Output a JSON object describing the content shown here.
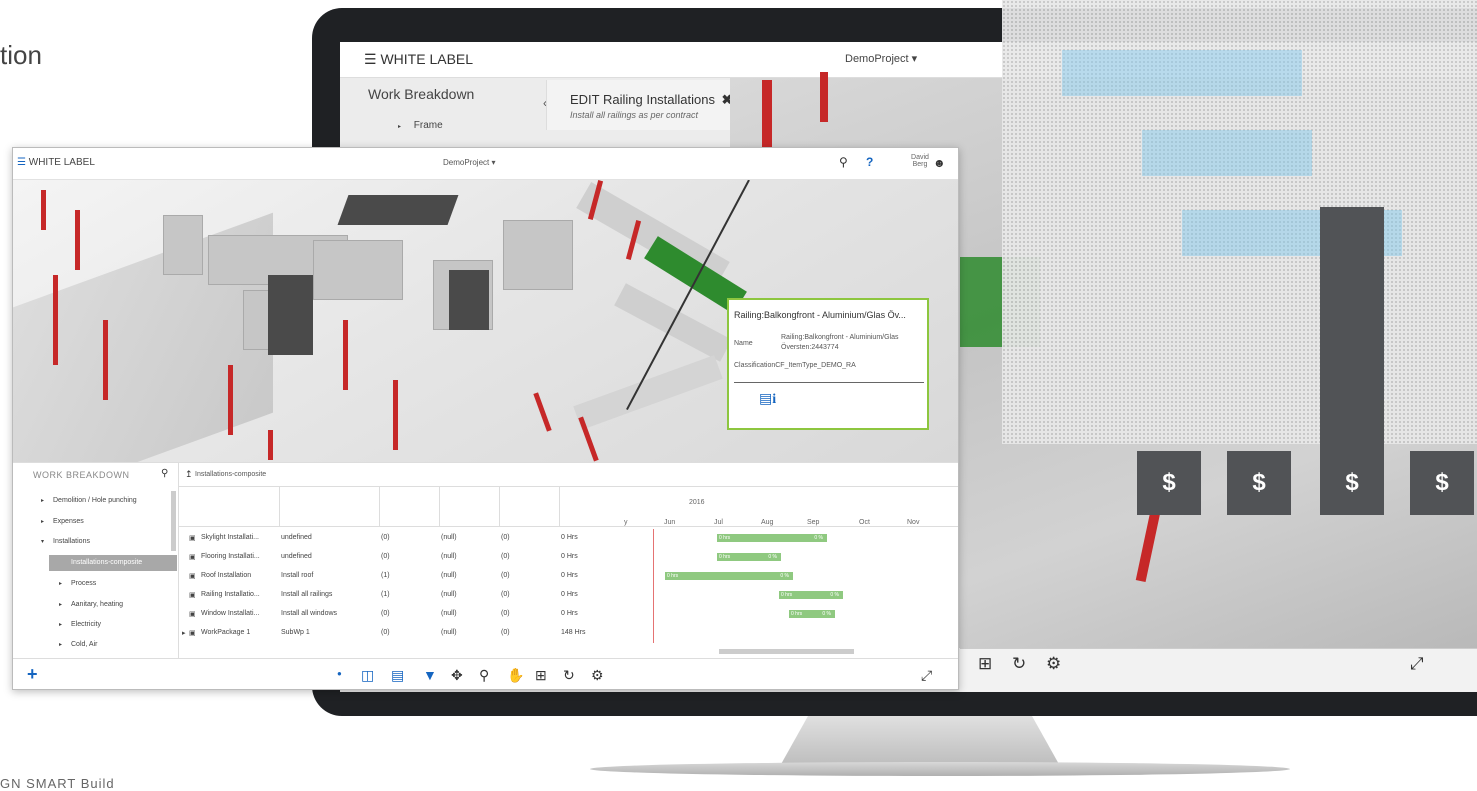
{
  "page": {
    "left_fragment": "tion",
    "bottom_fragment": "GN SMART Build"
  },
  "back_app": {
    "brand": "WHITE LABEL",
    "project": "DemoProject",
    "work_breakdown_title": "Work Breakdown",
    "tree_item": "Frame",
    "edit_title": "EDIT Railing Installations",
    "edit_subtitle": "Install all railings as per contract"
  },
  "dollar_tiles": [
    "$",
    "$",
    "$",
    "$"
  ],
  "front_app": {
    "brand": "WHITE LABEL",
    "project": "DemoProject",
    "user": {
      "first": "David",
      "last": "Berg"
    },
    "popup": {
      "title": "Railing:Balkongfront - Aluminium/Glas Öv...",
      "name_label": "Name",
      "name_value_1": "Railing:Balkongfront - Aluminium/Glas",
      "name_value_2": "Översten:2443774",
      "classification": "ClassificationCF_ItemType_DEMO_RA"
    },
    "work_breakdown": {
      "title": "WORK BREAKDOWN",
      "items": [
        {
          "label": "Demolition / Hole punching"
        },
        {
          "label": "Expenses"
        },
        {
          "label": "Installations"
        },
        {
          "label": "Installations-composite"
        },
        {
          "label": "Process"
        },
        {
          "label": "Aanitary, heating"
        },
        {
          "label": "Electricity"
        },
        {
          "label": "Cold, Air"
        }
      ]
    },
    "grid": {
      "breadcrumb": "Installations-composite",
      "year": "2016",
      "months": [
        "y",
        "Jun",
        "Jul",
        "Aug",
        "Sep",
        "Oct",
        "Nov"
      ],
      "rows": [
        {
          "name": "Skylight Installati...",
          "desc": "undefined",
          "list": "(0)",
          "res": "(null)",
          "deps": "(0)",
          "hrs": "0 Hrs"
        },
        {
          "name": "Flooring Installati...",
          "desc": "undefined",
          "list": "(0)",
          "res": "(null)",
          "deps": "(0)",
          "hrs": "0 Hrs"
        },
        {
          "name": "Roof Installation",
          "desc": "Install roof",
          "list": "(1)",
          "res": "(null)",
          "deps": "(0)",
          "hrs": "0 Hrs"
        },
        {
          "name": "Railing Installatio...",
          "desc": "Install all railings",
          "list": "(1)",
          "res": "(null)",
          "deps": "(0)",
          "hrs": "0 Hrs"
        },
        {
          "name": "Window Installati...",
          "desc": "Install all windows",
          "list": "(0)",
          "res": "(null)",
          "deps": "(0)",
          "hrs": "0 Hrs"
        },
        {
          "name": "WorkPackage 1",
          "desc": "SubWp 1",
          "list": "(0)",
          "res": "(null)",
          "deps": "(0)",
          "hrs": "148 Hrs"
        }
      ],
      "gantt_bars": [
        {
          "start_label": "0 hrs",
          "end_label": "0 %"
        },
        {
          "start_label": "0 hrs",
          "end_label": "0 %"
        },
        {
          "start_label": "0 hrs",
          "end_label": "0 %"
        },
        {
          "start_label": "0 hrs",
          "end_label": "0 %"
        },
        {
          "start_label": "0 hrs",
          "end_label": "0 %"
        }
      ]
    }
  },
  "colors": {
    "accent": "#1565c0",
    "rail": "#c62828",
    "highlight": "#2e8b2e",
    "gantt": "#8fc980"
  }
}
